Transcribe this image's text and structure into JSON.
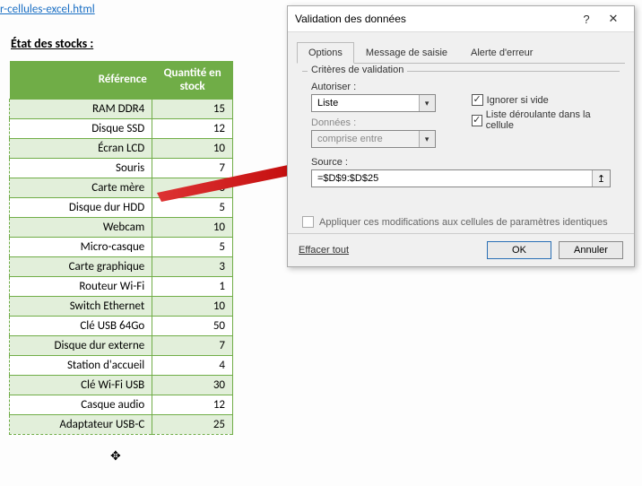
{
  "link_fragment": "r-cellules-excel.html",
  "heading": "État des stocks :",
  "table": {
    "headers": {
      "ref": "Référence",
      "qty": "Quantité en stock"
    },
    "rows": [
      {
        "ref": "RAM DDR4",
        "qty": 15
      },
      {
        "ref": "Disque SSD",
        "qty": 12
      },
      {
        "ref": "Écran LCD",
        "qty": 10
      },
      {
        "ref": "Souris",
        "qty": 7
      },
      {
        "ref": "Carte mère",
        "qty": 8
      },
      {
        "ref": "Disque dur HDD",
        "qty": 5
      },
      {
        "ref": "Webcam",
        "qty": 10
      },
      {
        "ref": "Micro-casque",
        "qty": 5
      },
      {
        "ref": "Carte graphique",
        "qty": 3
      },
      {
        "ref": "Routeur Wi-Fi",
        "qty": 1
      },
      {
        "ref": "Switch Ethernet",
        "qty": 10
      },
      {
        "ref": "Clé USB 64Go",
        "qty": 50
      },
      {
        "ref": "Disque dur externe",
        "qty": 7
      },
      {
        "ref": "Station d'accueil",
        "qty": 4
      },
      {
        "ref": "Clé Wi-Fi USB",
        "qty": 30
      },
      {
        "ref": "Casque audio",
        "qty": 12
      },
      {
        "ref": "Adaptateur USB-C",
        "qty": 25
      }
    ]
  },
  "dialog": {
    "title": "Validation des données",
    "help_icon": "?",
    "close_icon": "✕",
    "tabs": {
      "options": "Options",
      "input_msg": "Message de saisie",
      "error_alert": "Alerte d'erreur"
    },
    "fieldset_legend": "Critères de validation",
    "allow_label": "Autoriser :",
    "allow_value": "Liste",
    "data_label": "Données :",
    "data_value": "comprise entre",
    "ignore_blank": "Ignorer si vide",
    "in_cell_dropdown": "Liste déroulante dans la cellule",
    "source_label": "Source :",
    "source_value": "=$D$9:$D$25",
    "range_icon": "↥",
    "apply_label": "Appliquer ces modifications aux cellules de paramètres identiques",
    "clear_all": "Effacer tout",
    "ok": "OK",
    "cancel": "Annuler",
    "checkmark": "✓",
    "dropdown_arrow": "▾"
  }
}
